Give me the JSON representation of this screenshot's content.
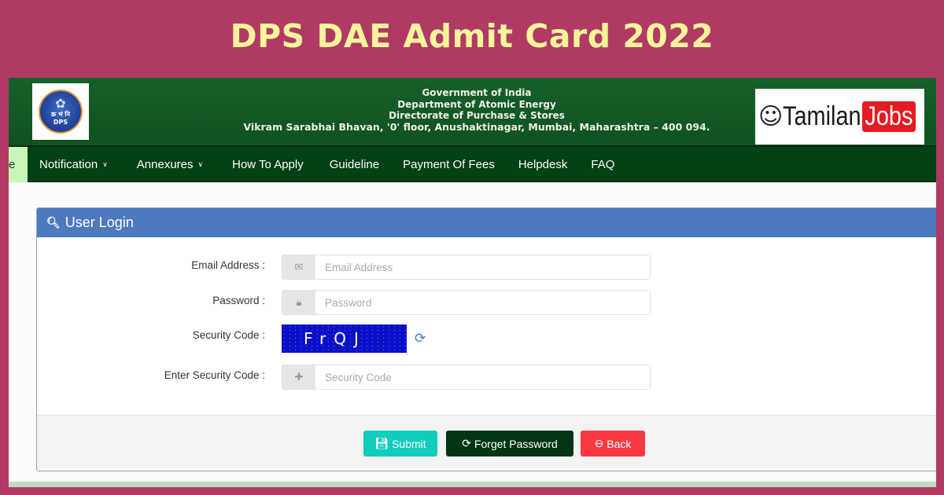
{
  "banner": {
    "title": "DPS DAE Admit Card 2022"
  },
  "header": {
    "logo_text": "DPS",
    "logo_devanagari": "क्र भं नि",
    "lines": [
      "Government of India",
      "Department of Atomic Energy",
      "Directorate of Purchase & Stores",
      "Vikram Sarabhai Bhavan, '0' floor, Anushaktinagar, Mumbai, Maharashtra – 400 094."
    ],
    "watermark": {
      "word1": "Tamilan",
      "word2": "Jobs"
    }
  },
  "nav": {
    "home_stub": "e",
    "items": [
      {
        "label": "Notification",
        "has_dropdown": true
      },
      {
        "label": "Annexures",
        "has_dropdown": true
      },
      {
        "label": "How To Apply",
        "has_dropdown": false
      },
      {
        "label": "Guideline",
        "has_dropdown": false
      },
      {
        "label": "Payment Of Fees",
        "has_dropdown": false
      },
      {
        "label": "Helpdesk",
        "has_dropdown": false
      },
      {
        "label": "FAQ",
        "has_dropdown": false
      }
    ],
    "chevron": "⌄"
  },
  "login": {
    "title": "User Login",
    "title_icon": "search-icon",
    "fields": {
      "email": {
        "label": "Email Address :",
        "placeholder": "Email Address",
        "value": "",
        "icon": "envelope-icon"
      },
      "password": {
        "label": "Password :",
        "placeholder": "Password",
        "value": "",
        "icon": "lock-icon"
      },
      "security_code": {
        "label": "Security Code :",
        "captcha_text": "FrQJ",
        "refresh_icon": "refresh-icon"
      },
      "enter_code": {
        "label": "Enter Security Code :",
        "placeholder": "Security Code",
        "value": "",
        "icon": "puzzle-icon"
      }
    },
    "buttons": {
      "submit": "Submit",
      "forget": "Forget Password",
      "back": "Back"
    }
  },
  "colors": {
    "banner_bg": "#b13a65",
    "banner_title": "#f7f59a",
    "header_green": "#0f5221",
    "nav_green": "#034014",
    "panel_head": "#4d79bf",
    "submit": "#10cdbc",
    "forget": "#023513",
    "back": "#f93943",
    "captcha_bg": "#0a10c8"
  }
}
